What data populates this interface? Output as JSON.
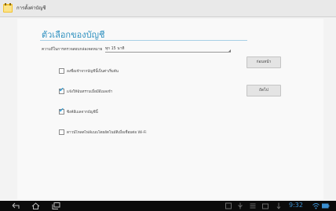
{
  "app": {
    "title": "การตั้งค่าบัญชี",
    "icon": "notebook-app-icon"
  },
  "section": {
    "heading": "ตัวเลือกของบัญชี"
  },
  "sync": {
    "label": "ความถี่ในการตรวจสอบกล่องจดหมาย",
    "value": "ทุก 15 นาที"
  },
  "options": [
    {
      "label": "ลงชื่อเข้าจากบัญชีนี้เป็นค่าเริ่มต้น",
      "checked": false
    },
    {
      "label": "แจ้งให้ฉันทราบเมื่อมีอีเมลเข้า",
      "checked": true
    },
    {
      "label": "ซิงค์อีเมลจากบัญชีนี้",
      "checked": true
    },
    {
      "label": "ดาวน์โหลดไฟล์แนบโดยอัตโนมัติเมื่อเชื่อมต่อ Wi-Fi",
      "checked": false
    }
  ],
  "buttons": {
    "previous": "ก่อนหน้า",
    "next": "ถัดไป"
  },
  "navbar": {
    "icons": [
      "back-icon",
      "home-icon",
      "recent-apps-icon",
      "screenshot-icon",
      "usb-icon",
      "keyboard-icon",
      "download-icon",
      "wifi-icon",
      "battery-icon"
    ],
    "time": "9:32"
  },
  "colors": {
    "accent": "#2c8fbf",
    "check": "#2a9ad6",
    "navbar": "#0b0b0b"
  }
}
